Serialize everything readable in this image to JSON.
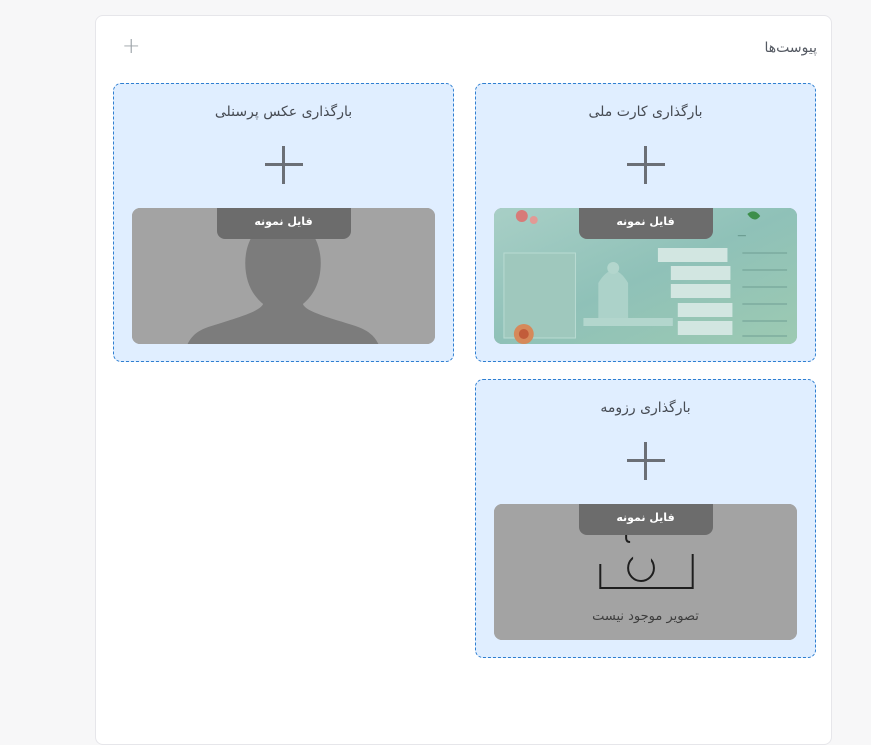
{
  "attachments": {
    "title": "پیوست‌ها",
    "add_icon": "plus-icon"
  },
  "cards": {
    "national_card": {
      "title": "بارگذاری کارت ملی",
      "sample_label": "فایل نمونه"
    },
    "personal_photo": {
      "title": "بارگذاری عکس پرسنلی",
      "sample_label": "فایل نمونه"
    },
    "resume": {
      "title": "بارگذاری رزومه",
      "sample_label": "فایل نمونه",
      "missing_image_text": "تصویر موجود نیست"
    }
  },
  "colors": {
    "card_background": "#e0eeff",
    "card_border": "#2f7fd1",
    "sample_tag": "#6c6c6c"
  }
}
